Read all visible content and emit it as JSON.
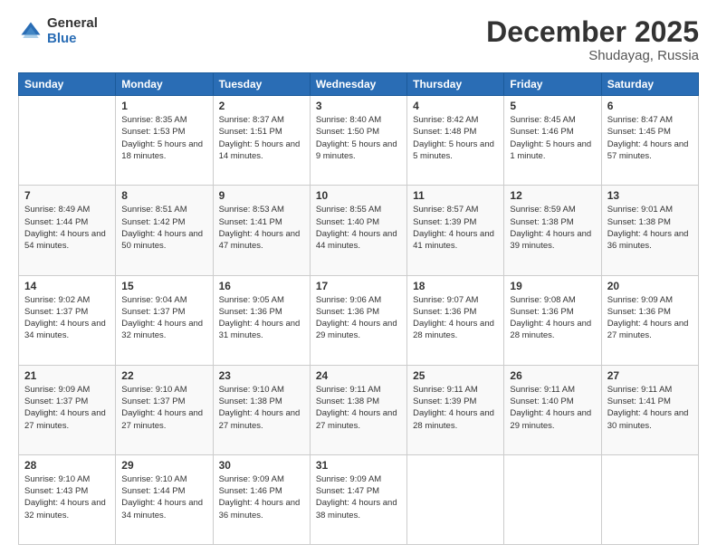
{
  "logo": {
    "general": "General",
    "blue": "Blue",
    "icon_color": "#2a6db5"
  },
  "header": {
    "title": "December 2025",
    "location": "Shudayag, Russia"
  },
  "weekdays": [
    "Sunday",
    "Monday",
    "Tuesday",
    "Wednesday",
    "Thursday",
    "Friday",
    "Saturday"
  ],
  "weeks": [
    [
      {
        "day": "",
        "sunrise": "",
        "sunset": "",
        "daylight": ""
      },
      {
        "day": "1",
        "sunrise": "Sunrise: 8:35 AM",
        "sunset": "Sunset: 1:53 PM",
        "daylight": "Daylight: 5 hours and 18 minutes."
      },
      {
        "day": "2",
        "sunrise": "Sunrise: 8:37 AM",
        "sunset": "Sunset: 1:51 PM",
        "daylight": "Daylight: 5 hours and 14 minutes."
      },
      {
        "day": "3",
        "sunrise": "Sunrise: 8:40 AM",
        "sunset": "Sunset: 1:50 PM",
        "daylight": "Daylight: 5 hours and 9 minutes."
      },
      {
        "day": "4",
        "sunrise": "Sunrise: 8:42 AM",
        "sunset": "Sunset: 1:48 PM",
        "daylight": "Daylight: 5 hours and 5 minutes."
      },
      {
        "day": "5",
        "sunrise": "Sunrise: 8:45 AM",
        "sunset": "Sunset: 1:46 PM",
        "daylight": "Daylight: 5 hours and 1 minute."
      },
      {
        "day": "6",
        "sunrise": "Sunrise: 8:47 AM",
        "sunset": "Sunset: 1:45 PM",
        "daylight": "Daylight: 4 hours and 57 minutes."
      }
    ],
    [
      {
        "day": "7",
        "sunrise": "Sunrise: 8:49 AM",
        "sunset": "Sunset: 1:44 PM",
        "daylight": "Daylight: 4 hours and 54 minutes."
      },
      {
        "day": "8",
        "sunrise": "Sunrise: 8:51 AM",
        "sunset": "Sunset: 1:42 PM",
        "daylight": "Daylight: 4 hours and 50 minutes."
      },
      {
        "day": "9",
        "sunrise": "Sunrise: 8:53 AM",
        "sunset": "Sunset: 1:41 PM",
        "daylight": "Daylight: 4 hours and 47 minutes."
      },
      {
        "day": "10",
        "sunrise": "Sunrise: 8:55 AM",
        "sunset": "Sunset: 1:40 PM",
        "daylight": "Daylight: 4 hours and 44 minutes."
      },
      {
        "day": "11",
        "sunrise": "Sunrise: 8:57 AM",
        "sunset": "Sunset: 1:39 PM",
        "daylight": "Daylight: 4 hours and 41 minutes."
      },
      {
        "day": "12",
        "sunrise": "Sunrise: 8:59 AM",
        "sunset": "Sunset: 1:38 PM",
        "daylight": "Daylight: 4 hours and 39 minutes."
      },
      {
        "day": "13",
        "sunrise": "Sunrise: 9:01 AM",
        "sunset": "Sunset: 1:38 PM",
        "daylight": "Daylight: 4 hours and 36 minutes."
      }
    ],
    [
      {
        "day": "14",
        "sunrise": "Sunrise: 9:02 AM",
        "sunset": "Sunset: 1:37 PM",
        "daylight": "Daylight: 4 hours and 34 minutes."
      },
      {
        "day": "15",
        "sunrise": "Sunrise: 9:04 AM",
        "sunset": "Sunset: 1:37 PM",
        "daylight": "Daylight: 4 hours and 32 minutes."
      },
      {
        "day": "16",
        "sunrise": "Sunrise: 9:05 AM",
        "sunset": "Sunset: 1:36 PM",
        "daylight": "Daylight: 4 hours and 31 minutes."
      },
      {
        "day": "17",
        "sunrise": "Sunrise: 9:06 AM",
        "sunset": "Sunset: 1:36 PM",
        "daylight": "Daylight: 4 hours and 29 minutes."
      },
      {
        "day": "18",
        "sunrise": "Sunrise: 9:07 AM",
        "sunset": "Sunset: 1:36 PM",
        "daylight": "Daylight: 4 hours and 28 minutes."
      },
      {
        "day": "19",
        "sunrise": "Sunrise: 9:08 AM",
        "sunset": "Sunset: 1:36 PM",
        "daylight": "Daylight: 4 hours and 28 minutes."
      },
      {
        "day": "20",
        "sunrise": "Sunrise: 9:09 AM",
        "sunset": "Sunset: 1:36 PM",
        "daylight": "Daylight: 4 hours and 27 minutes."
      }
    ],
    [
      {
        "day": "21",
        "sunrise": "Sunrise: 9:09 AM",
        "sunset": "Sunset: 1:37 PM",
        "daylight": "Daylight: 4 hours and 27 minutes."
      },
      {
        "day": "22",
        "sunrise": "Sunrise: 9:10 AM",
        "sunset": "Sunset: 1:37 PM",
        "daylight": "Daylight: 4 hours and 27 minutes."
      },
      {
        "day": "23",
        "sunrise": "Sunrise: 9:10 AM",
        "sunset": "Sunset: 1:38 PM",
        "daylight": "Daylight: 4 hours and 27 minutes."
      },
      {
        "day": "24",
        "sunrise": "Sunrise: 9:11 AM",
        "sunset": "Sunset: 1:38 PM",
        "daylight": "Daylight: 4 hours and 27 minutes."
      },
      {
        "day": "25",
        "sunrise": "Sunrise: 9:11 AM",
        "sunset": "Sunset: 1:39 PM",
        "daylight": "Daylight: 4 hours and 28 minutes."
      },
      {
        "day": "26",
        "sunrise": "Sunrise: 9:11 AM",
        "sunset": "Sunset: 1:40 PM",
        "daylight": "Daylight: 4 hours and 29 minutes."
      },
      {
        "day": "27",
        "sunrise": "Sunrise: 9:11 AM",
        "sunset": "Sunset: 1:41 PM",
        "daylight": "Daylight: 4 hours and 30 minutes."
      }
    ],
    [
      {
        "day": "28",
        "sunrise": "Sunrise: 9:10 AM",
        "sunset": "Sunset: 1:43 PM",
        "daylight": "Daylight: 4 hours and 32 minutes."
      },
      {
        "day": "29",
        "sunrise": "Sunrise: 9:10 AM",
        "sunset": "Sunset: 1:44 PM",
        "daylight": "Daylight: 4 hours and 34 minutes."
      },
      {
        "day": "30",
        "sunrise": "Sunrise: 9:09 AM",
        "sunset": "Sunset: 1:46 PM",
        "daylight": "Daylight: 4 hours and 36 minutes."
      },
      {
        "day": "31",
        "sunrise": "Sunrise: 9:09 AM",
        "sunset": "Sunset: 1:47 PM",
        "daylight": "Daylight: 4 hours and 38 minutes."
      },
      {
        "day": "",
        "sunrise": "",
        "sunset": "",
        "daylight": ""
      },
      {
        "day": "",
        "sunrise": "",
        "sunset": "",
        "daylight": ""
      },
      {
        "day": "",
        "sunrise": "",
        "sunset": "",
        "daylight": ""
      }
    ]
  ]
}
